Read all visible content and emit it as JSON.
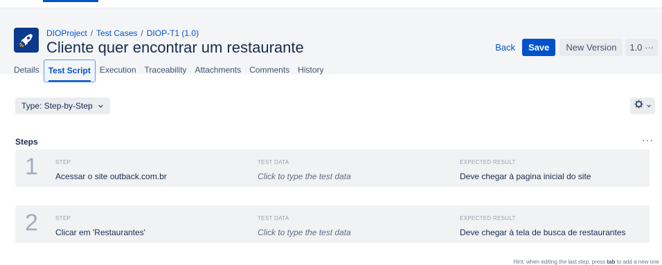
{
  "breadcrumb": {
    "project": "DIOProject",
    "separator": "/",
    "section": "Test Cases",
    "item": "DIOP-T1 (1.0)"
  },
  "title": "Cliente quer encontrar um restaurante",
  "actions": {
    "back": "Back",
    "save": "Save",
    "new_version": "New Version",
    "version": "1.0 ···"
  },
  "tabs": [
    "Details",
    "Test Script",
    "Execution",
    "Traceability",
    "Attachments",
    "Comments",
    "History"
  ],
  "active_tab": "Test Script",
  "type_dropdown": "Type: Step-by-Step",
  "steps_heading": "Steps",
  "columns": {
    "step": "STEP",
    "test_data": "TEST DATA",
    "expected": "EXPECTED RESULT"
  },
  "steps": [
    {
      "number": "1",
      "step": "Acessar o site outback.com.br",
      "test_data": "Click to type the test data",
      "expected": "Deve chegar à pagina inicial do site"
    },
    {
      "number": "2",
      "step": "Clicar em 'Restaurantes'",
      "test_data": "Click to type the test data",
      "expected": "Deve chegar à tela de busca de restaurantes"
    }
  ],
  "hint": {
    "before": "Hint: when editing the last step, press ",
    "key": "tab",
    "after": " to add a new one"
  },
  "colors": {
    "primary": "#0052cc",
    "header_bg": "#f4f5f7",
    "step_bg": "#f1f2f4"
  }
}
